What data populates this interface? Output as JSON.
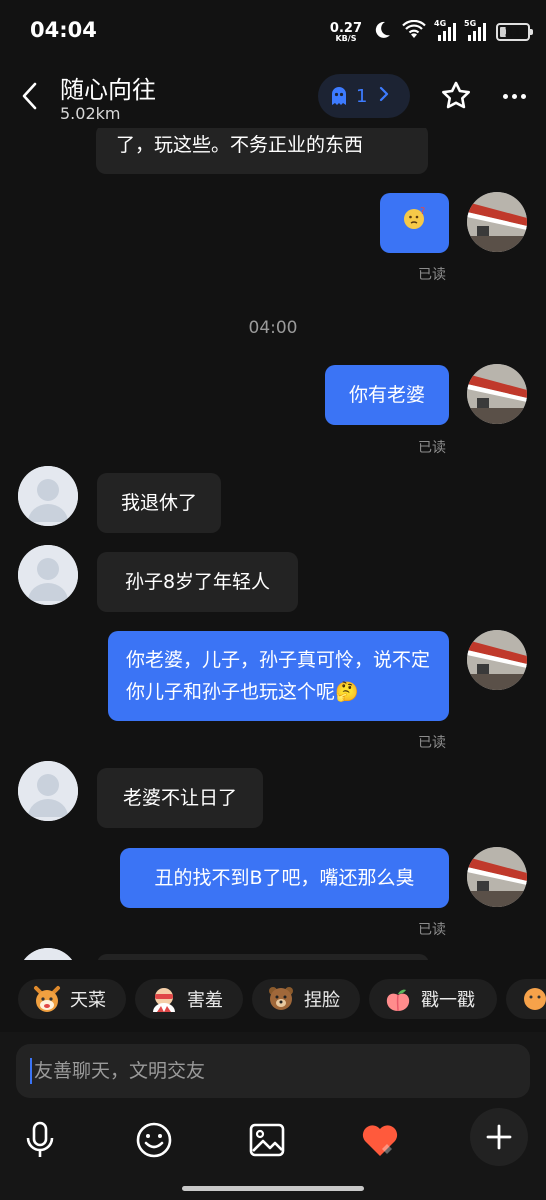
{
  "status": {
    "time": "04:04",
    "speed_value": "0.27",
    "speed_unit": "KB/S",
    "net1": "4G",
    "net2": "5G",
    "battery": "21"
  },
  "header": {
    "title": "随心向往",
    "distance": "5.02km",
    "pill_count": "1"
  },
  "messages": [
    {
      "dir": "in",
      "text": "了，玩这些。不务正业的东西"
    },
    {
      "dir": "out",
      "text": "",
      "emoji": "thinking-emoji",
      "read": "已读"
    },
    {
      "dir": "out",
      "text": "你有老婆",
      "read": "已读"
    },
    {
      "dir": "in",
      "text": "我退休了"
    },
    {
      "dir": "in",
      "text": "孙子8岁了年轻人"
    },
    {
      "dir": "out",
      "text": "你老婆，儿子，孙子真可怜，说不定你儿子和孙子也玩这个呢🤔",
      "read": "已读"
    },
    {
      "dir": "in",
      "text": "老婆不让日了"
    },
    {
      "dir": "out",
      "text": "丑的找不到B了吧，嘴还那么臭",
      "read": "已读"
    }
  ],
  "timestamp": "04:00",
  "quick_reactions": [
    {
      "label": "天菜",
      "icon": "dog-emoji-icon"
    },
    {
      "label": "害羞",
      "icon": "shy-emoji-icon"
    },
    {
      "label": "捏脸",
      "icon": "bear-emoji-icon"
    },
    {
      "label": "戳一戳",
      "icon": "peach-emoji-icon"
    }
  ],
  "input": {
    "placeholder": "友善聊天，文明交友"
  },
  "colors": {
    "accent": "#3b74f5",
    "background": "#121212",
    "incoming_bubble": "#232323",
    "heart": "#ff5a3c"
  }
}
